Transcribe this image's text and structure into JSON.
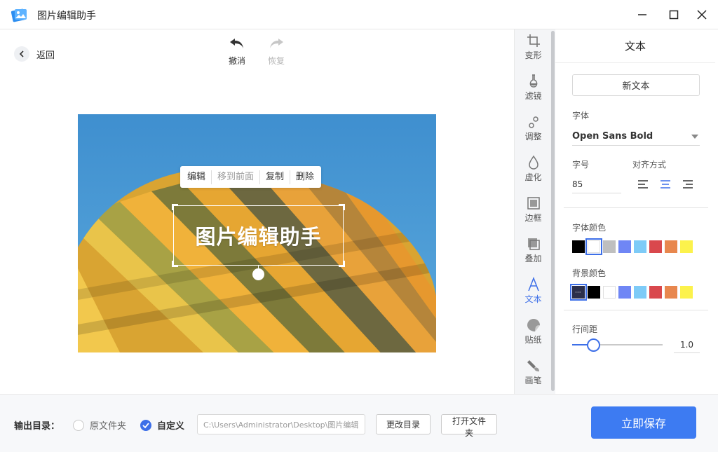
{
  "app": {
    "title": "图片编辑助手"
  },
  "toolbar": {
    "back_label": "返回",
    "undo_label": "撤消",
    "redo_label": "恢复"
  },
  "context_menu": {
    "items": [
      "编辑",
      "移到前面",
      "复制",
      "删除"
    ]
  },
  "canvas": {
    "text_content": "图片编辑助手"
  },
  "tools": [
    {
      "label": "变形",
      "icon": "crop-icon"
    },
    {
      "label": "滤镜",
      "icon": "flask-icon"
    },
    {
      "label": "调整",
      "icon": "adjust-icon"
    },
    {
      "label": "虚化",
      "icon": "drop-icon"
    },
    {
      "label": "边框",
      "icon": "frame-icon"
    },
    {
      "label": "叠加",
      "icon": "overlay-icon"
    },
    {
      "label": "文本",
      "icon": "text-icon",
      "active": true
    },
    {
      "label": "贴纸",
      "icon": "sticker-icon"
    },
    {
      "label": "画笔",
      "icon": "brush-icon"
    }
  ],
  "panel": {
    "title": "文本",
    "new_text_label": "新文本",
    "font_label": "字体",
    "font_value": "Open Sans Bold",
    "size_label": "字号",
    "size_value": "85",
    "align_label": "对齐方式",
    "align_selected": "center",
    "font_color_label": "字体颜色",
    "font_colors": [
      "#000000",
      "#ffffff",
      "#bfbfbf",
      "#6f86f5",
      "#7ecbf7",
      "#d9484d",
      "#e8874e",
      "#fcf24c"
    ],
    "font_color_selected": 1,
    "bg_color_label": "背景颜色",
    "bg_colors": [
      "none",
      "#000000",
      "#ffffff",
      "#6f86f5",
      "#7ecbf7",
      "#d9484d",
      "#e8874e",
      "#fcf24c"
    ],
    "bg_color_selected": 0,
    "line_spacing_label": "行间距",
    "line_spacing_value": "1.0",
    "line_spacing_fraction": 0.23
  },
  "bottom": {
    "output_label": "输出目录：",
    "radio_original": "原文件夹",
    "radio_custom": "自定义",
    "radio_selected": "custom",
    "path_value": "C:\\Users\\Administrator\\Desktop\\图片编辑",
    "change_dir_label": "更改目录",
    "open_folder_label": "打开文件夹",
    "save_label": "立即保存"
  },
  "colors": {
    "accent": "#3d7bf2",
    "selected": "#3d6fe8"
  }
}
